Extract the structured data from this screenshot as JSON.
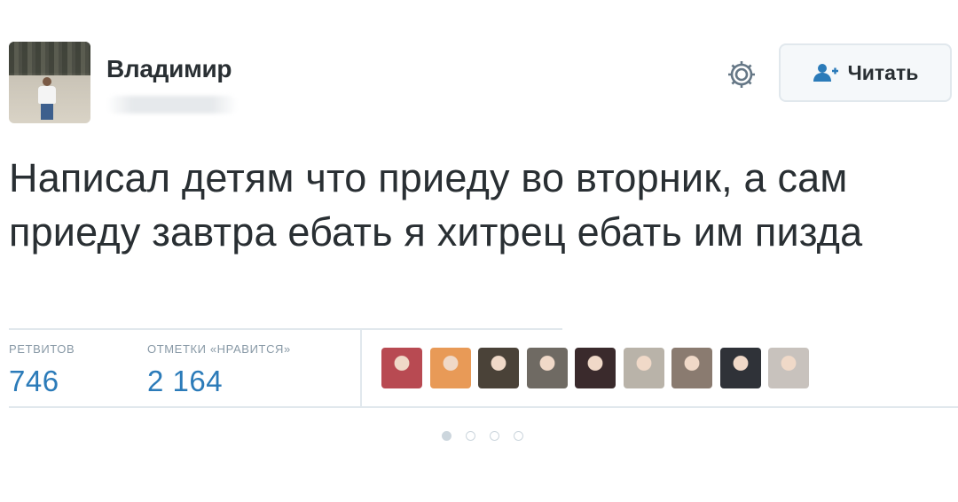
{
  "user": {
    "name": "Владимир",
    "avatar_icon": "profile-photo-man-walking"
  },
  "header": {
    "gear_icon": "gear-icon",
    "follow_label": "Читать",
    "follow_icon": "follow-person-icon",
    "accent_color": "#2b7bb9"
  },
  "tweet": {
    "text": "Написал детям что приеду во вторник, а сам приеду завтра ебать я хитрец ебать им пизда"
  },
  "stats": {
    "retweets_label": "РЕТВИТОВ",
    "retweets_value": "746",
    "likes_label": "ОТМЕТКИ «НРАВИТСЯ»",
    "likes_value": "2 164"
  },
  "likers": [
    {
      "icon": "liker-avatar-1",
      "color": "#b84a52"
    },
    {
      "icon": "liker-avatar-2",
      "color": "#e89a57"
    },
    {
      "icon": "liker-avatar-3",
      "color": "#4a4238"
    },
    {
      "icon": "liker-avatar-4",
      "color": "#6f6a63"
    },
    {
      "icon": "liker-avatar-5",
      "color": "#3a2a2c"
    },
    {
      "icon": "liker-avatar-6",
      "color": "#b9b3a9"
    },
    {
      "icon": "liker-avatar-7",
      "color": "#8a7b70"
    },
    {
      "icon": "liker-avatar-8",
      "color": "#2f3238"
    },
    {
      "icon": "liker-avatar-9",
      "color": "#c8c2bd"
    }
  ],
  "pagination": {
    "pages": 4,
    "active_page": 1
  }
}
